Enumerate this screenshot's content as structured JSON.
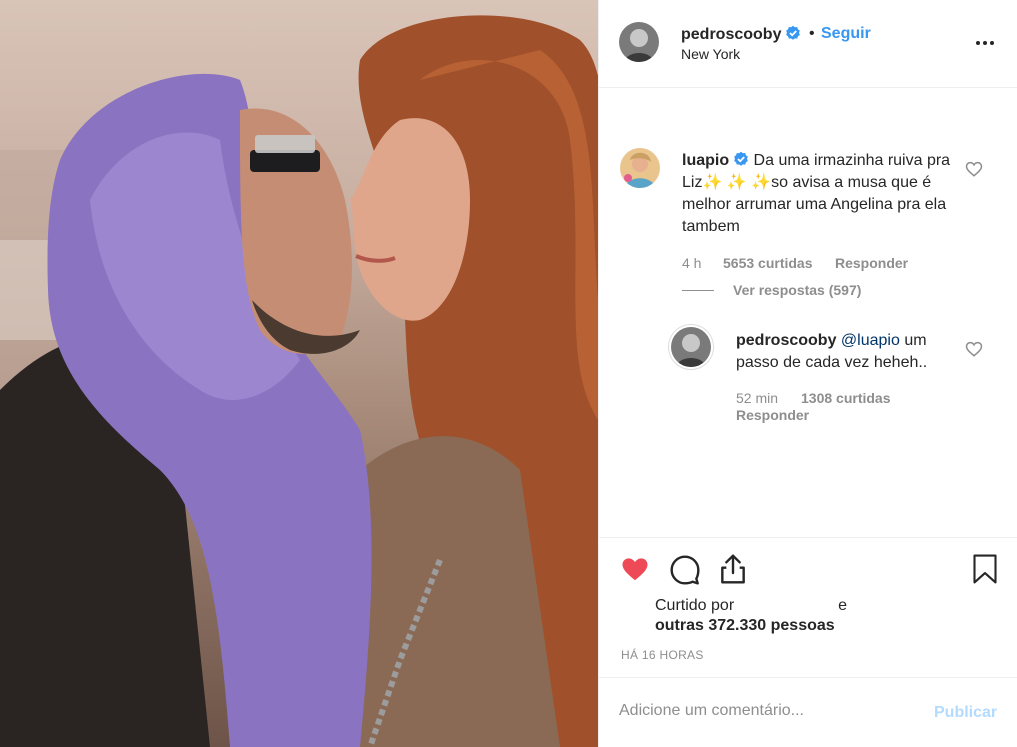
{
  "post": {
    "author": "pedroscooby",
    "follow_label": "Seguir",
    "separator": "•",
    "location": "New York"
  },
  "comments": [
    {
      "username": "luapio",
      "text_part1": " Da uma irmazinha ruiva pra Liz",
      "emoji": "✨ ✨ ✨",
      "text_part2": "so avisa a musa que é melhor arrumar uma Angelina pra ela tambem",
      "time": "4 h",
      "likes": "5653 curtidas",
      "reply_label": "Responder",
      "view_replies": "Ver respostas (597)"
    }
  ],
  "reply": {
    "username": "pedroscooby",
    "mention": "@luapio",
    "text": " um passo de cada vez heheh..",
    "time": "52 min",
    "likes": "1308 curtidas",
    "reply_label": "Responder"
  },
  "likes": {
    "prefix": "Curtido por",
    "conjunction": "e",
    "others": "outras 372.330 pessoas"
  },
  "timestamp": "HÁ 16 HORAS",
  "composer": {
    "placeholder": "Adicione um comentário...",
    "publish_label": "Publicar"
  },
  "icons": {
    "like": "heart-icon",
    "comment": "comment-icon",
    "share": "share-icon",
    "save": "bookmark-icon",
    "more": "more-icon",
    "verified": "verified-badge-icon"
  },
  "colors": {
    "link": "#3897f0",
    "liked": "#ed4956",
    "muted": "#8e8e8e",
    "publish_disabled": "#b3dbff",
    "mention": "#003569"
  }
}
